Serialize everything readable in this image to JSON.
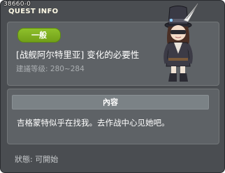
{
  "window": {
    "quest_id": "38660-0",
    "title": "QUEST INFO"
  },
  "quest": {
    "category": "一般",
    "name": "[战舰阿尔特里亚] 变化的必要性",
    "level_label": "建議等级:",
    "level_range": "280~284"
  },
  "content": {
    "header": "內容",
    "text": "吉格蒙特似乎在找我。去作战中心见她吧。"
  },
  "status": {
    "label": "狀態:",
    "value": "可開始"
  },
  "colors": {
    "window_bg": "#4a4d51",
    "panel_bg": "#5e6266",
    "badge_green": "#8ec02b",
    "section_header": "#7b8286"
  },
  "icons": {
    "npc": "npc-portrait-top-hat-feather"
  }
}
